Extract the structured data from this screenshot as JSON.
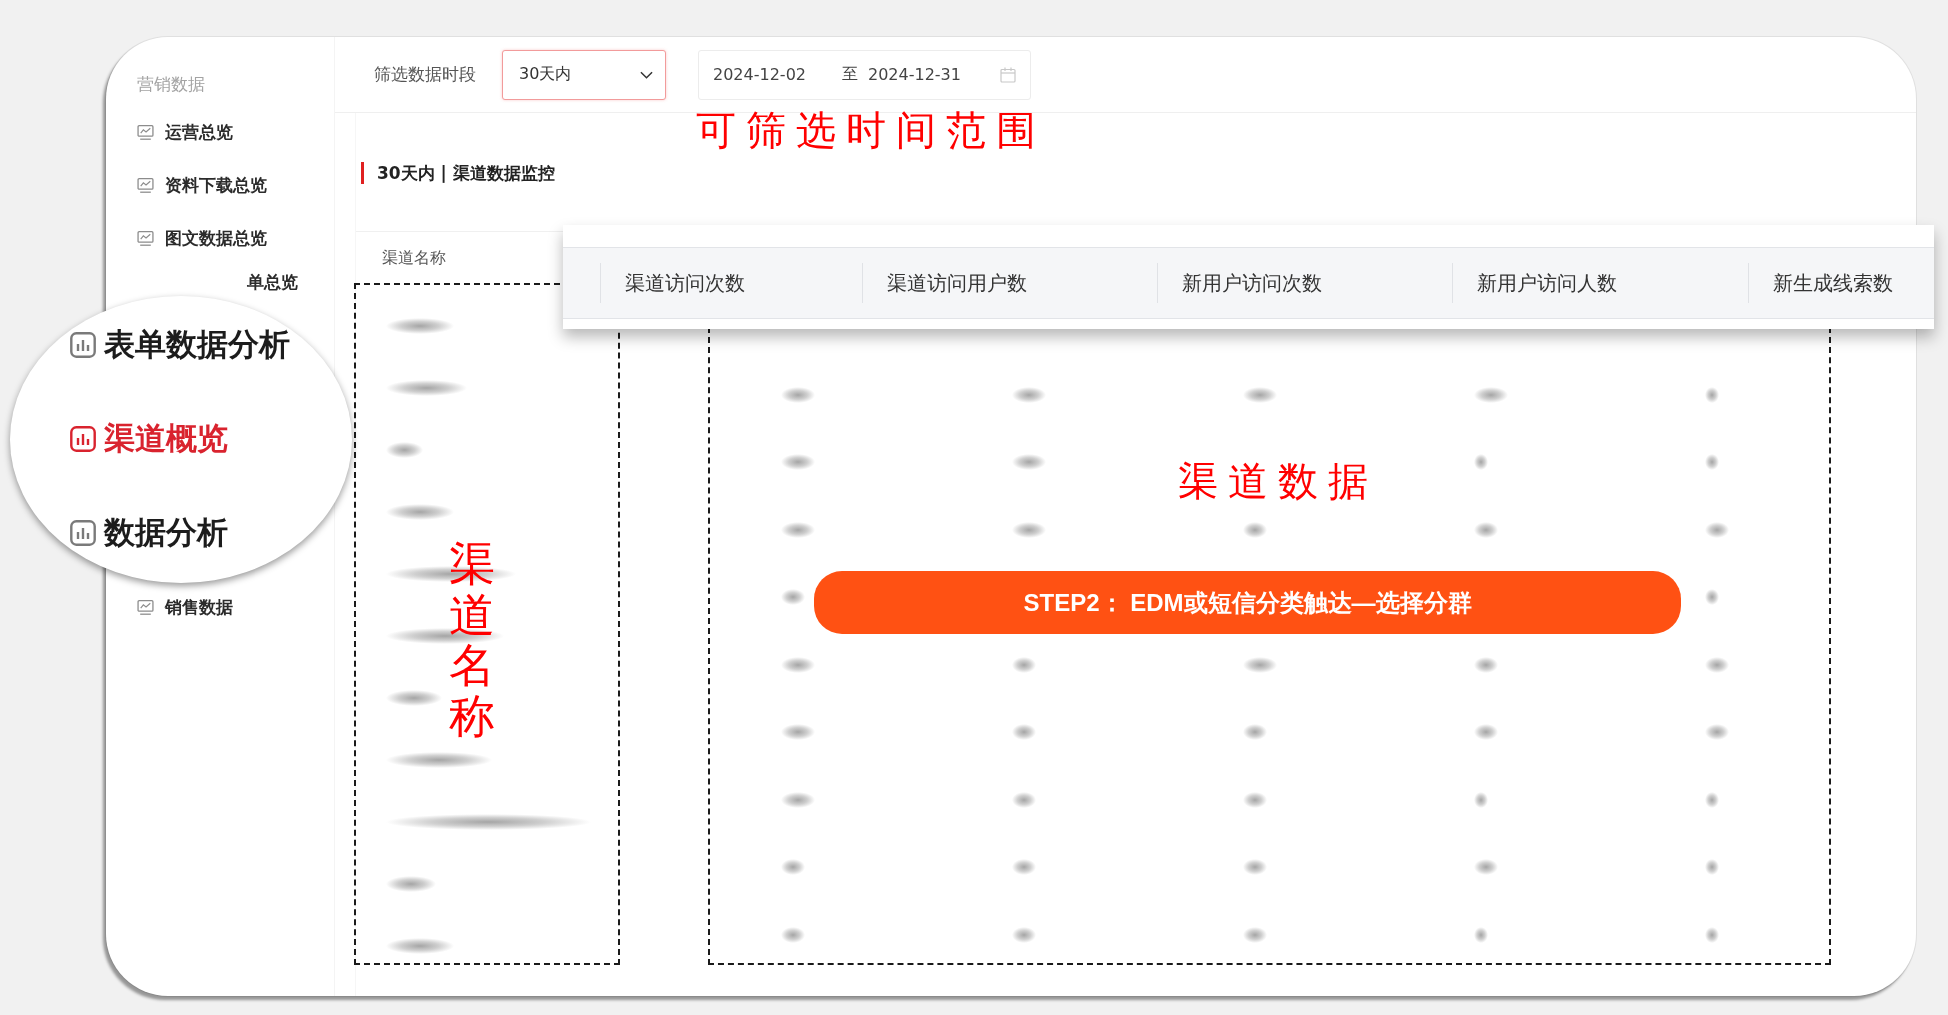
{
  "sidebar": {
    "section_title": "营销数据",
    "items": [
      {
        "label": "运营总览",
        "selected": false
      },
      {
        "label": "资料下载总览",
        "selected": false
      },
      {
        "label": "图文数据总览",
        "selected": false
      }
    ],
    "partly_hidden_item": {
      "label": "单总览",
      "selected": false
    },
    "items_below_magnifier": [
      {
        "label": "销售数据",
        "selected": false
      }
    ]
  },
  "magnifier": {
    "items": [
      {
        "label": "表单数据分析",
        "selected": false
      },
      {
        "label": "渠道概览",
        "selected": true
      },
      {
        "label": "数据分析",
        "selected": false
      }
    ]
  },
  "filter_bar": {
    "label": "筛选数据时段",
    "period_select": {
      "value": "30天内"
    },
    "date_range": {
      "start": "2024-12-02",
      "separator": "至",
      "end": "2024-12-31"
    }
  },
  "section_title": "30天内 | 渠道数据监控",
  "table": {
    "columns": [
      "渠道名称"
    ]
  },
  "header_callout": {
    "columns": [
      "渠道访问次数",
      "渠道访问用户数",
      "新用户访问次数",
      "新用户访问人数",
      "新生成线索数"
    ]
  },
  "annotations": [
    {
      "kind": "horizontal",
      "text": "可筛选时间范围"
    },
    {
      "kind": "vertical",
      "text": "渠道名称"
    },
    {
      "kind": "horizontal",
      "text": "渠道数据"
    }
  ],
  "step_banner": {
    "text": "STEP2： EDM或短信分类触达—选择分群"
  }
}
